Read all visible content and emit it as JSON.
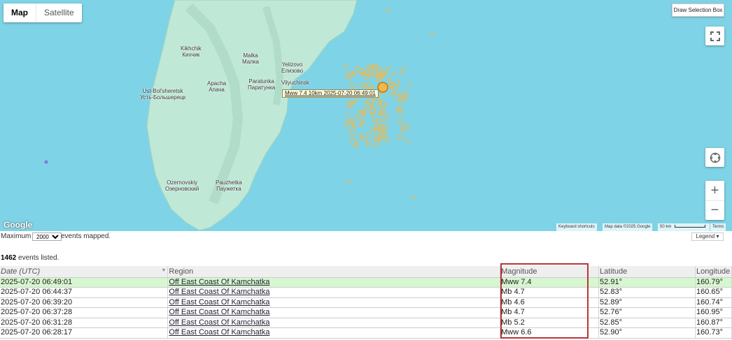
{
  "map": {
    "type_buttons": [
      "Map",
      "Satellite"
    ],
    "active_type": "Map",
    "draw_selection_label": "Draw Selection Box",
    "zoom_in": "+",
    "zoom_out": "−",
    "tooltip": "Mww 7.4   10km   2025-07-20 06:49:01",
    "places": [
      {
        "en": "Kikhchik",
        "ru": "Кихчик"
      },
      {
        "en": "Malka",
        "ru": "Малка"
      },
      {
        "en": "Yelizovo",
        "ru": "Елизово"
      },
      {
        "en": "Apacha",
        "ru": "Апача"
      },
      {
        "en": "Paratunka",
        "ru": "Паратунка"
      },
      {
        "en": "Vilyuchinsk",
        "ru": "Вилючинск"
      },
      {
        "en": "Ust-Bol'sheretsk",
        "ru": "Усть-Большерецк"
      },
      {
        "en": "Ozernovskiy",
        "ru": "Озерновский"
      },
      {
        "en": "Pauzhetka",
        "ru": "Паужетка"
      }
    ],
    "google_logo": "Google",
    "attribution": {
      "shortcuts": "Keyboard shortcuts",
      "data": "Map data ©2025 Google",
      "scale": "50 km",
      "terms": "Terms"
    },
    "icons": {
      "fullscreen": "fullscreen-icon",
      "pegman": "location-icon"
    }
  },
  "mapbar": {
    "max_label": "Maximum",
    "max_value": "2000",
    "mapped_label": "events mapped.",
    "legend_label": "Legend ▾"
  },
  "listed": {
    "count": "1462",
    "suffix": "events listed."
  },
  "table": {
    "headers": [
      "Date (UTC)",
      "Region",
      "Magnitude",
      "Latitude",
      "Longitude"
    ],
    "rows": [
      {
        "date": "2025-07-20 06:49:01",
        "region": "Off East Coast Of Kamchatka",
        "mag": "Mww 7.4",
        "lat": "52.91°",
        "lon": "160.79°"
      },
      {
        "date": "2025-07-20 06:44:37",
        "region": "Off East Coast Of Kamchatka",
        "mag": "Mb 4.7",
        "lat": "52.83°",
        "lon": "160.65°"
      },
      {
        "date": "2025-07-20 06:39:20",
        "region": "Off East Coast Of Kamchatka",
        "mag": "Mb 4.6",
        "lat": "52.89°",
        "lon": "160.74°"
      },
      {
        "date": "2025-07-20 06:37:28",
        "region": "Off East Coast Of Kamchatka",
        "mag": "Mb 4.7",
        "lat": "52.76°",
        "lon": "160.95°"
      },
      {
        "date": "2025-07-20 06:31:28",
        "region": "Off East Coast Of Kamchatka",
        "mag": "Mb 5.2",
        "lat": "52.85°",
        "lon": "160.87°"
      },
      {
        "date": "2025-07-20 06:28:17",
        "region": "Off East Coast Of Kamchatka",
        "mag": "Mww 6.6",
        "lat": "52.90°",
        "lon": "160.73°"
      }
    ]
  },
  "colors": {
    "water": "#7fd3e6",
    "land": "#bfe8d6",
    "event": "#f2b84b",
    "highlight_row": "#d6f7cf",
    "annotation_box": "#b5373a"
  }
}
